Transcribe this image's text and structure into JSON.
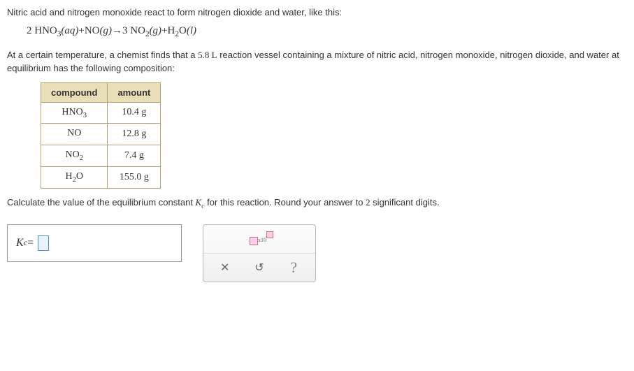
{
  "intro_text": "Nitric acid and nitrogen monoxide react to form nitrogen dioxide and water, like this:",
  "equation": {
    "lhs_coef1": "2",
    "lhs_sp1": "HNO",
    "lhs_sp1_sub": "3",
    "lhs_sp1_state": "(aq)",
    "plus1": "+",
    "lhs_sp2": "NO",
    "lhs_sp2_state": "(g)",
    "arrow": "→",
    "rhs_coef1": "3",
    "rhs_sp1": "NO",
    "rhs_sp1_sub": "2",
    "rhs_sp1_state": "(g)",
    "plus2": "+",
    "rhs_sp2a": "H",
    "rhs_sp2a_sub": "2",
    "rhs_sp2b": "O",
    "rhs_sp2_state": "(l)"
  },
  "context_text_1": "At a certain temperature, a chemist finds that a ",
  "vessel_volume": "5.8 L",
  "context_text_2": " reaction vessel containing a mixture of nitric acid, nitrogen monoxide, nitrogen dioxide, and water at equilibrium has the following composition:",
  "table": {
    "head_compound": "compound",
    "head_amount": "amount",
    "rows": [
      {
        "compound_main": "HNO",
        "compound_sub": "3",
        "amount": "10.4 g"
      },
      {
        "compound_main": "NO",
        "compound_sub": "",
        "amount": "12.8 g"
      },
      {
        "compound_main": "NO",
        "compound_sub": "2",
        "amount": "7.4 g"
      },
      {
        "compound_main": "H",
        "compound_sub": "2",
        "compound_tail": "O",
        "amount": "155.0 g"
      }
    ]
  },
  "question_text_1": "Calculate the value of the equilibrium constant ",
  "kc_symbol": "K",
  "kc_sub": "c",
  "question_text_2": " for this reaction. Round your answer to ",
  "sig_digits": "2",
  "question_text_3": " significant digits.",
  "answer_prefix_K": "K",
  "answer_prefix_sub": "c",
  "answer_equals": " = ",
  "tools": {
    "sci_label": "x10",
    "clear": "✕",
    "reset": "↺",
    "help": "?"
  }
}
